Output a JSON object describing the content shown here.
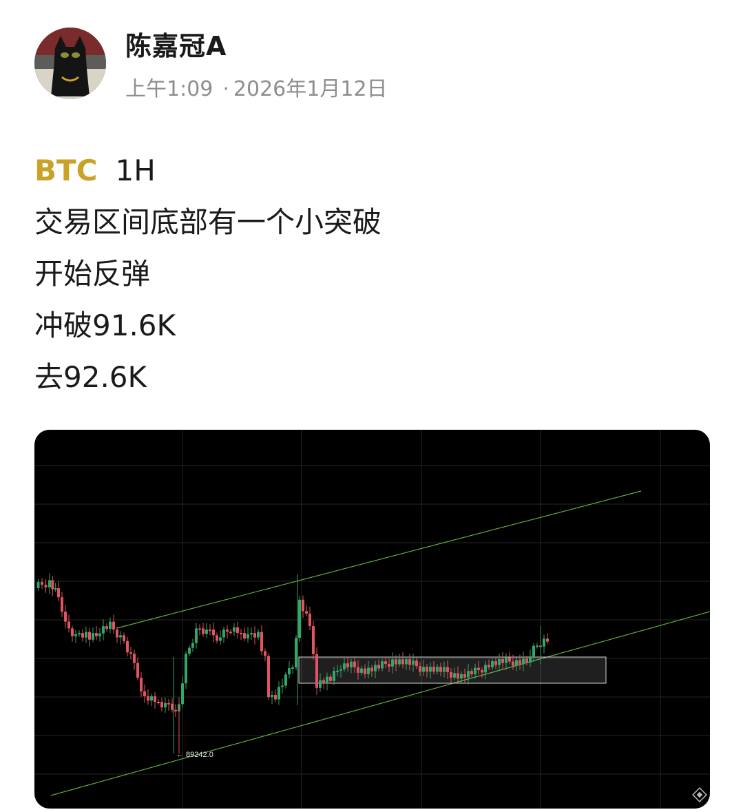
{
  "post": {
    "author": "陈嘉冠A",
    "time": "上午1:09",
    "date": "2026年1月12日",
    "ticker": "BTC",
    "timeframe": "1H",
    "lines": [
      "交易区间底部有一个小突破",
      "开始反弹",
      "冲破91.6K",
      "去92.6K"
    ]
  },
  "chart_data": {
    "type": "candlestick",
    "annotations": [
      "← 89242.0"
    ],
    "low_marker": 89242.0,
    "colors": {
      "up": "#2fa869",
      "down": "#e05561",
      "trendline": "#5fae3c",
      "background": "#000000"
    },
    "grid": true
  }
}
